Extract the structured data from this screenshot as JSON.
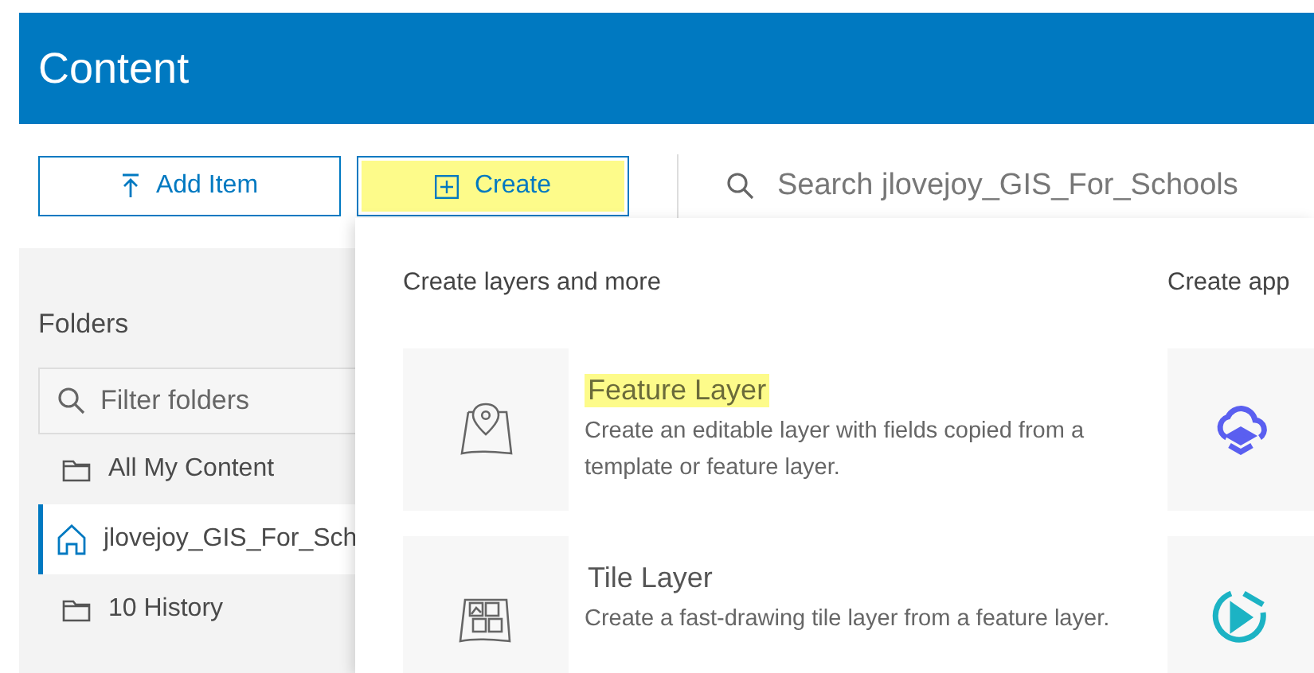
{
  "header": {
    "title": "Content"
  },
  "toolbar": {
    "add_item": {
      "label": "Add Item"
    },
    "create": {
      "label": "Create",
      "highlighted": true
    },
    "search": {
      "placeholder": "Search jlovejoy_GIS_For_Schools"
    }
  },
  "sidebar": {
    "heading": "Folders",
    "filter": {
      "placeholder": "Filter folders"
    },
    "folders": [
      {
        "label": "All My Content",
        "kind": "folder",
        "selected": false
      },
      {
        "label": "jlovejoy_GIS_For_Sch",
        "kind": "home",
        "selected": true
      },
      {
        "label": "10 History",
        "kind": "folder",
        "selected": false
      }
    ]
  },
  "create_menu": {
    "layers": {
      "heading": "Create layers and more",
      "items": [
        {
          "kind": "feature",
          "title": "Feature Layer",
          "description": "Create an editable layer with fields copied from a template or feature layer.",
          "highlighted": true
        },
        {
          "kind": "tile",
          "title": "Tile Layer",
          "description": "Create a fast-drawing tile layer from a feature layer.",
          "highlighted": false
        }
      ]
    },
    "apps": {
      "heading": "Create app",
      "items": [
        {
          "kind": "cloud"
        },
        {
          "kind": "play"
        }
      ]
    }
  }
}
